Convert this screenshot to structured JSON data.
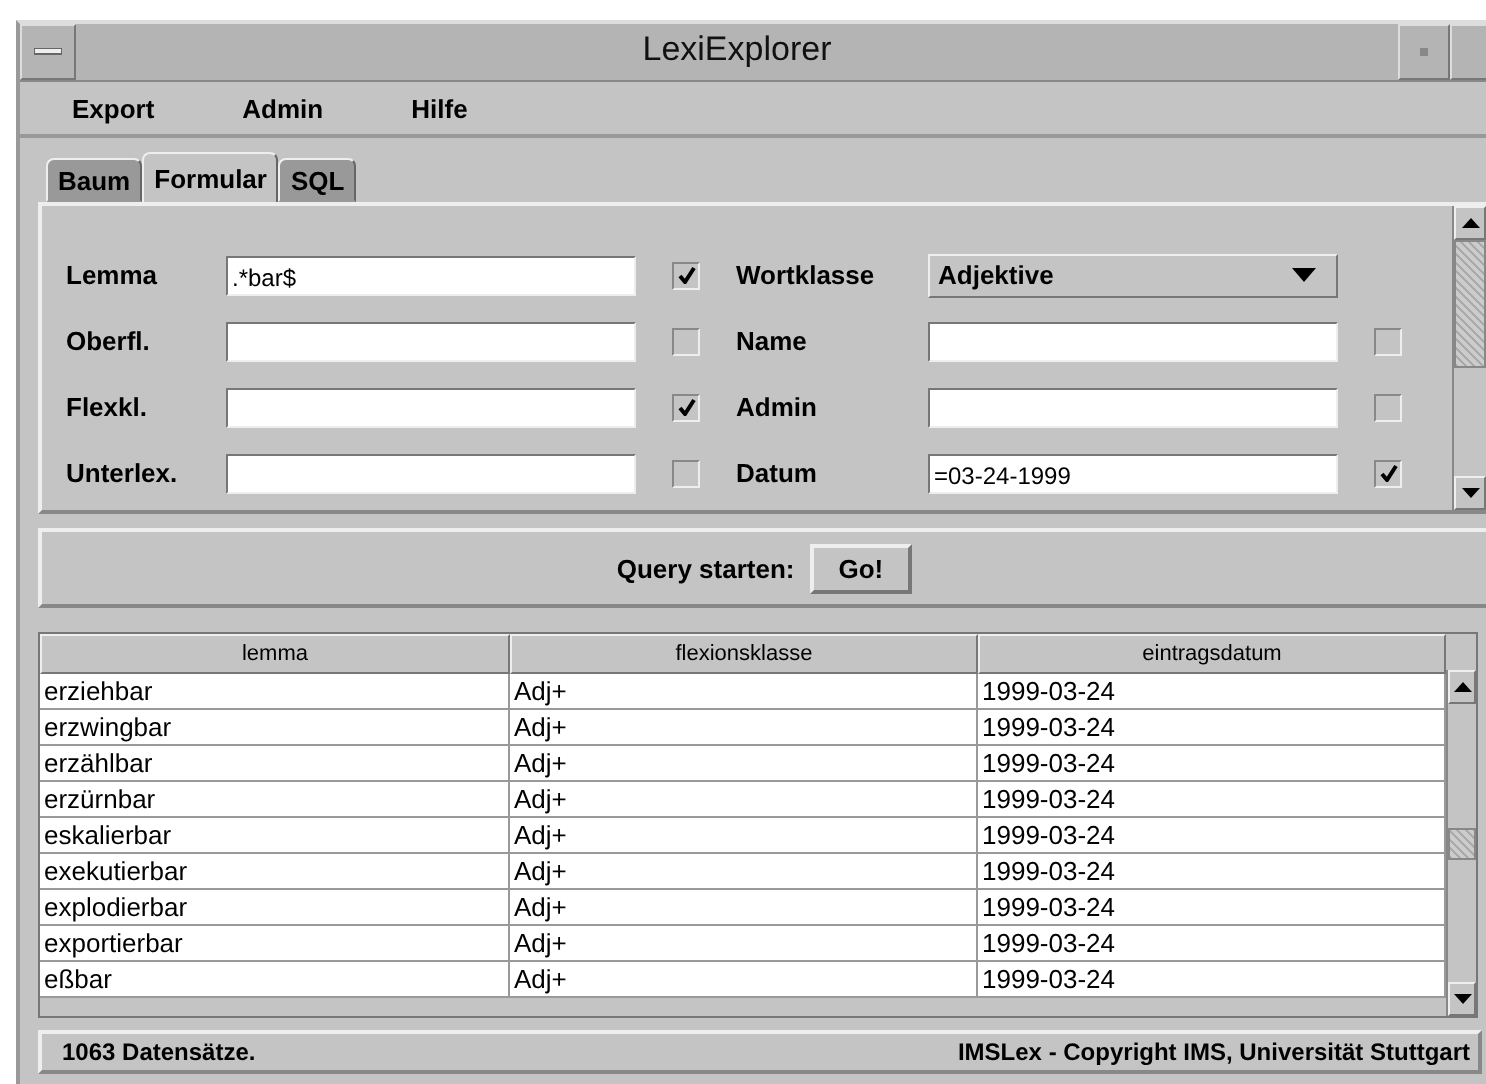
{
  "window": {
    "title": "LexiExplorer"
  },
  "menu": [
    "Export",
    "Admin",
    "Hilfe"
  ],
  "tabs": [
    {
      "label": "Baum",
      "selected": false
    },
    {
      "label": "Formular",
      "selected": true
    },
    {
      "label": "SQL",
      "selected": false
    }
  ],
  "form": {
    "rows": [
      {
        "left": {
          "label": "Lemma",
          "value": ".*bar$",
          "checked": true
        },
        "right": {
          "label": "Wortklasse",
          "kind": "dropdown",
          "value": "Adjektive"
        }
      },
      {
        "left": {
          "label": "Oberfl.",
          "checked": false
        },
        "right": {
          "label": "Name",
          "kind": "text",
          "checked": false
        }
      },
      {
        "left": {
          "label": "Flexkl.",
          "checked": true
        },
        "right": {
          "label": "Admin",
          "kind": "text",
          "checked": false
        }
      },
      {
        "left": {
          "label": "Unterlex.",
          "checked": false
        },
        "right": {
          "label": "Datum",
          "kind": "text",
          "value": "=03-24-1999",
          "checked": true
        }
      }
    ]
  },
  "query": {
    "label": "Query starten:",
    "button": "Go!"
  },
  "table": {
    "columns": [
      "lemma",
      "flexionsklasse",
      "eintragsdatum"
    ],
    "rows": [
      [
        "erziehbar",
        "Adj+",
        "1999-03-24"
      ],
      [
        "erzwingbar",
        "Adj+",
        "1999-03-24"
      ],
      [
        "erzählbar",
        "Adj+",
        "1999-03-24"
      ],
      [
        "erzürnbar",
        "Adj+",
        "1999-03-24"
      ],
      [
        "eskalierbar",
        "Adj+",
        "1999-03-24"
      ],
      [
        "exekutierbar",
        "Adj+",
        "1999-03-24"
      ],
      [
        "explodierbar",
        "Adj+",
        "1999-03-24"
      ],
      [
        "exportierbar",
        "Adj+",
        "1999-03-24"
      ],
      [
        "eßbar",
        "Adj+",
        "1999-03-24"
      ]
    ]
  },
  "status_bar": {
    "left": "1063 Datensätze.",
    "right": "IMSLex - Copyright IMS, Universität Stuttgart"
  }
}
